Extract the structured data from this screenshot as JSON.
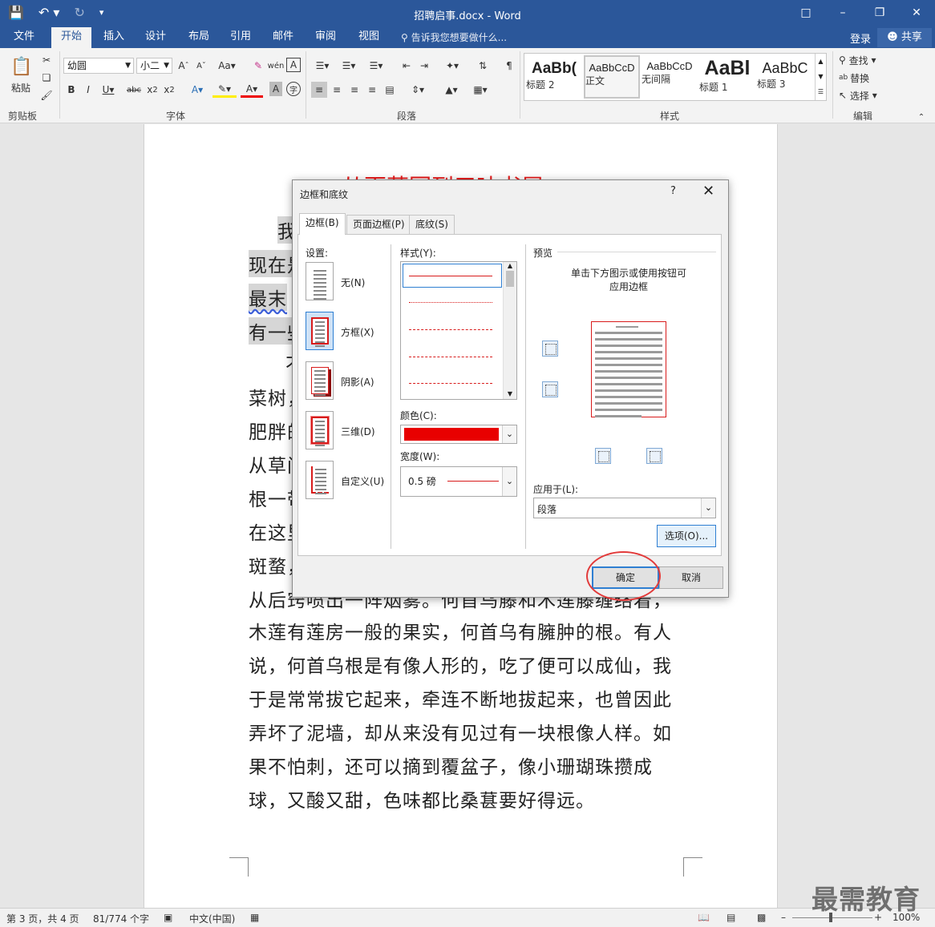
{
  "titlebar": {
    "title": "招聘启事.docx - Word"
  },
  "ribbon_tabs": [
    "文件",
    "开始",
    "插入",
    "设计",
    "布局",
    "引用",
    "邮件",
    "审阅",
    "视图"
  ],
  "active_tab": "开始",
  "tell_me": "告诉我您想要做什么...",
  "login": "登录",
  "share": "共享",
  "clipboard": {
    "paste": "粘贴",
    "group": "剪贴板"
  },
  "font": {
    "name": "幼圆",
    "size": "小二",
    "group": "字体"
  },
  "paragraph": {
    "group": "段落"
  },
  "styles": {
    "group": "样式",
    "items": [
      {
        "sample": "AaBb(",
        "name": "标题 2"
      },
      {
        "sample": "AaBbCcD",
        "name": "正文"
      },
      {
        "sample": "AaBbCcD",
        "name": "无间隔"
      },
      {
        "sample": "AaBl",
        "name": "标题 1"
      },
      {
        "sample": "AaBbC",
        "name": "标题 3"
      }
    ]
  },
  "editing": {
    "find": "查找",
    "replace": "替换",
    "select": "选择",
    "group": "编辑"
  },
  "document": {
    "heading": "从百草园到三味书屋",
    "lines": [
      "我",
      "现在是",
      "最末",
      "有一些",
      "不",
      "菜树，",
      "肥胖的",
      "从草间",
      "根一带",
      "在这里",
      "斑蝥，",
      "从后窍喷出一阵烟雾。何首乌藤和木莲藤缠络着，",
      "木莲有莲房一般的果实，何首乌有臃肿的根。有人",
      "说，何首乌根是有像人形的，吃了便可以成仙，我",
      "于是常常拔它起来，牵连不断地拔起来，也曾因此",
      "弄坏了泥墙，却从来没有见过有一块根像人样。如",
      "果不怕刺，还可以摘到覆盆子，像小珊瑚珠攒成",
      "球，又酸又甜，色味都比桑葚要好得远。"
    ]
  },
  "dialog": {
    "title": "边框和底纹",
    "help": "?",
    "close": "✕",
    "tabs": [
      "边框(B)",
      "页面边框(P)",
      "底纹(S)"
    ],
    "setting_label": "设置:",
    "settings": [
      "无(N)",
      "方框(X)",
      "阴影(A)",
      "三维(D)",
      "自定义(U)"
    ],
    "style_label": "样式(Y):",
    "color_label": "颜色(C):",
    "color_value": "#e80000",
    "width_label": "宽度(W):",
    "width_value": "0.5 磅",
    "preview_label": "预览",
    "preview_hint_1": "单击下方图示或使用按钮可",
    "preview_hint_2": "应用边框",
    "apply_label": "应用于(L):",
    "apply_value": "段落",
    "options_btn": "选项(O)...",
    "ok_btn": "确定",
    "cancel_btn": "取消"
  },
  "status": {
    "page": "第 3 页，共 4 页",
    "words": "81/774 个字",
    "lang": "中文(中国)",
    "zoom": "100%"
  },
  "watermark": "最需教育"
}
